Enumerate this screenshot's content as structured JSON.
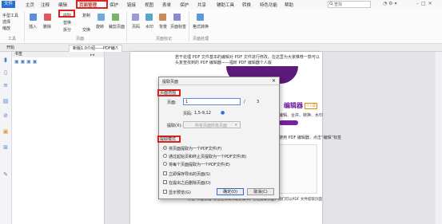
{
  "menubar": {
    "items": [
      "文件",
      "主页",
      "注释",
      "编辑",
      "页面管理",
      "保护",
      "链接",
      "视图",
      "表单",
      "保护",
      "共享",
      "辅助工具",
      "转换",
      "特色功能",
      "帮助"
    ],
    "active_index": 4,
    "search_placeholder": "查找"
  },
  "ribbon": {
    "rotate": "旋转",
    "insert": "插入",
    "delete": "删除",
    "extract": "提取",
    "copy": "复制",
    "replace": "替换",
    "split": "拆分",
    "swap": "交换",
    "crop_pages": "裁剪页面",
    "page_number": "页码",
    "watermark": "水印",
    "background": "背景",
    "page_label": "页面标签",
    "format_convert": "格式转换",
    "tools_labels": [
      "手型工具",
      "选择",
      "缩放"
    ],
    "group_tools": "工具",
    "group_pages": "页面",
    "group_page_mark": "页面标记",
    "group_page_handle": "页面处理"
  },
  "tabs": {
    "start": "开始",
    "doc": "新版1.0介绍——PDF编..."
  },
  "left_panel": {
    "header": "书签"
  },
  "page": {
    "line1": "若干处理 PDF 文件基本的编辑对 PDF 文件进行修改。在这里为大家推荐一款可以",
    "line2": "头复查找到的 PDF 编辑器——福昕 PDF 编辑器个人版",
    "brand_line": "编辑器",
    "badge": "个人版",
    "feature_line": "编辑、合并、转换、水印",
    "bottom_line": "使用 PDF 编辑器，点击“编辑”标签",
    "para": "点击“页面管理”标签后按实际需要操作，包括提取页面，我们可以PDF 文件提取页面"
  },
  "dialog": {
    "title": "提取页面",
    "section_pages": "页面范围",
    "pages_label": "页面:",
    "page_value": "1",
    "page_sep": "/",
    "page_total": "3",
    "range_label": "页码:",
    "range_example": "1,5-9,12",
    "extract_label": "提取(X):",
    "extract_select": "所有页面所有页面",
    "section_mode": "提取模式",
    "opt1": "将页面提取为一个PDF文件(F)",
    "opt2": "通过起始页和终止页提取为一个PDF文件(B)",
    "opt3": "将每个页面提取为一个PDF文件(E)",
    "chk1": "立即保存导出的页面(S)",
    "chk2": "在提出之后删除页面(D)",
    "chk3": "显示预览(G)",
    "ok": "确定(O)",
    "cancel": "取消(C)"
  },
  "colors": {
    "accent_red": "#e0201c",
    "menu_blue": "#2a6fd1",
    "purple": "#6a1b9a"
  }
}
